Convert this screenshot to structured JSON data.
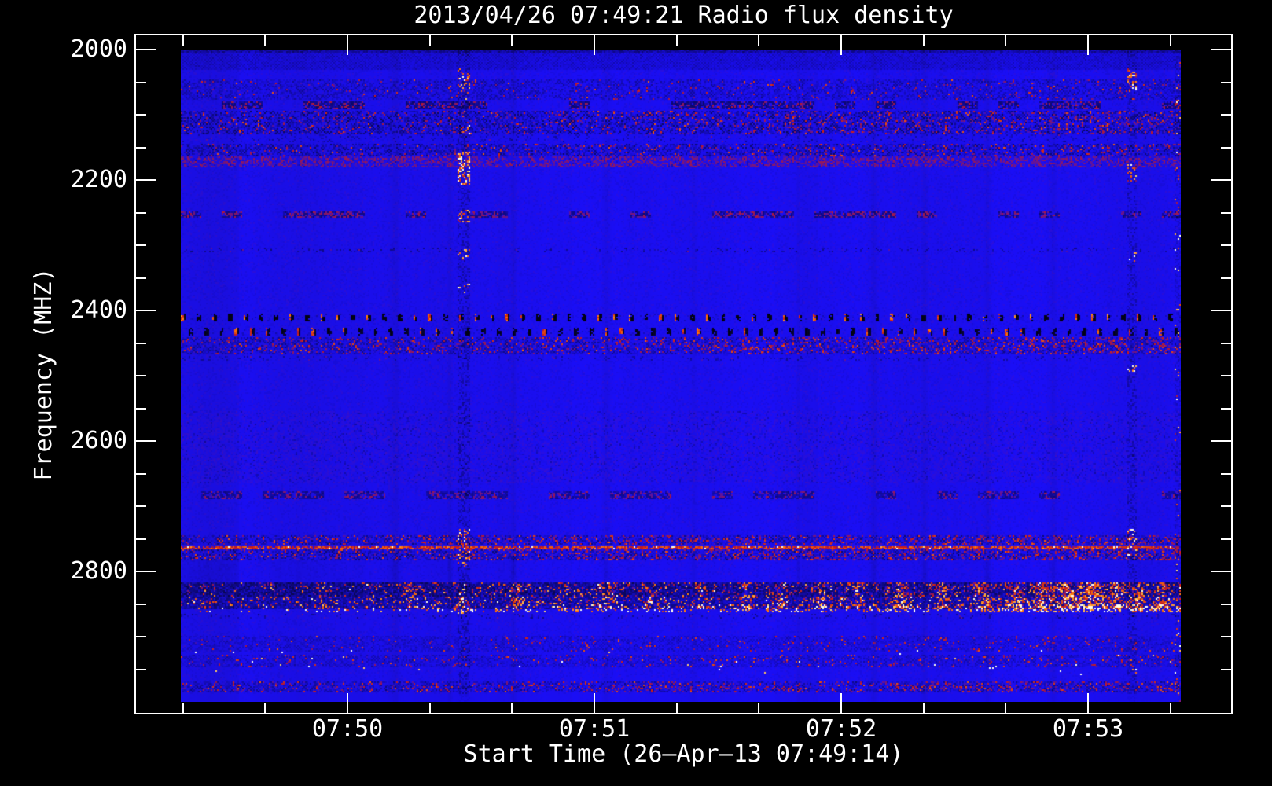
{
  "chart_data": {
    "type": "heatmap",
    "subtype": "radio-dynamic-spectrum",
    "title": "2013/04/26 07:49:21 Radio flux density",
    "xlabel": "Start Time (26–Apr–13 07:49:14)",
    "ylabel": "Frequency (MHZ)",
    "x_ticks": [
      "07:50",
      "07:51",
      "07:52",
      "07:53"
    ],
    "x_minor_step_seconds": 20,
    "y_ticks": [
      2000,
      2200,
      2400,
      2600,
      2800
    ],
    "y_minor_step_mhz": 50,
    "y_axis_increases_downward": true,
    "freq_range_mhz": [
      2000,
      3000
    ],
    "data_start_time": "07:49:21",
    "data_end_time_approx": "07:53:25",
    "grid": false,
    "legend": "none",
    "colormap": {
      "background_blue": "#1a0ee8",
      "dark": "#020214",
      "red": "#cd1c16",
      "orange": "#ff7a0a",
      "yellow": "#ffdc78",
      "white_hot": "#ffffeb"
    },
    "bands": [
      {
        "f0": 2000,
        "f1": 2004,
        "type": "dark",
        "s": 0.55
      },
      {
        "f0": 2005,
        "f1": 2032,
        "type": "checker",
        "s": 0.32
      },
      {
        "f0": 2046,
        "f1": 2077,
        "type": "mix",
        "s": 0.42,
        "redp": 0.05
      },
      {
        "f0": 2079,
        "f1": 2091,
        "type": "broken",
        "s": 0.5,
        "cov": 0.6,
        "red": 0.25
      },
      {
        "f0": 2093,
        "f1": 2129,
        "type": "mix",
        "s": 0.68,
        "redp": 0.16
      },
      {
        "f0": 2131,
        "f1": 2143,
        "type": "sparse",
        "s": 0.5
      },
      {
        "f0": 2145,
        "f1": 2163,
        "type": "mix",
        "s": 0.6,
        "redp": 0.12
      },
      {
        "f0": 2164,
        "f1": 2180,
        "type": "redfade",
        "s": 0.75
      },
      {
        "f0": 2249,
        "f1": 2257,
        "type": "broken",
        "s": 0.45,
        "cov": 0.5,
        "red": 0.45
      },
      {
        "f0": 2304,
        "f1": 2312,
        "type": "sparse",
        "s": 0.6
      },
      {
        "f0": 2406,
        "f1": 2417,
        "type": "dashes",
        "s": 0.9,
        "period": 19.6,
        "dash": 4.6,
        "phase": 0,
        "redp": 0.6
      },
      {
        "f0": 2427,
        "f1": 2439,
        "type": "dashes",
        "s": 0.8,
        "period": 19.6,
        "dash": 4.6,
        "phase": 9,
        "redp": 0.45
      },
      {
        "f0": 2442,
        "f1": 2467,
        "type": "mix",
        "s": 0.5,
        "redp": 0.2
      },
      {
        "f0": 2470,
        "f1": 2477,
        "type": "sparse",
        "s": 0.5
      },
      {
        "f0": 2555,
        "f1": 2665,
        "type": "redfade",
        "s": 0.1
      },
      {
        "f0": 2678,
        "f1": 2689,
        "type": "broken",
        "s": 0.4,
        "cov": 0.55,
        "red": 0.3
      },
      {
        "f0": 2744,
        "f1": 2760,
        "type": "mix",
        "s": 0.55,
        "redp": 0.22
      },
      {
        "f0": 2761,
        "f1": 2766,
        "type": "redline",
        "s": 0.8
      },
      {
        "f0": 2767,
        "f1": 2783,
        "type": "mix",
        "s": 0.6,
        "redp": 0.25
      },
      {
        "f0": 2784,
        "f1": 2816,
        "type": "vstripe",
        "s": 1
      },
      {
        "f0": 2818,
        "f1": 2857,
        "type": "hot",
        "s": 0.8
      },
      {
        "f0": 2850,
        "f1": 2862,
        "type": "hotdots",
        "s": 0.8
      },
      {
        "f0": 2864,
        "f1": 2872,
        "type": "sparse",
        "s": 0.6
      },
      {
        "f0": 2898,
        "f1": 2924,
        "type": "mix",
        "s": 0.3,
        "redp": 0.05
      },
      {
        "f0": 2927,
        "f1": 2947,
        "type": "mix",
        "s": 0.33,
        "redp": 0.07
      },
      {
        "f0": 2920,
        "f1": 2960,
        "type": "ydots",
        "s": 1
      },
      {
        "f0": 2968,
        "f1": 2986,
        "type": "mix",
        "s": 0.5,
        "redp": 0.2
      },
      {
        "f0": 2988,
        "f1": 3000,
        "type": "flat",
        "s": 1
      }
    ],
    "vertical_events": [
      {
        "x_frac": 0.2815,
        "w": 16,
        "dark": 0.5,
        "time_approx": "07:50:30",
        "ranges": [
          [
            2028,
            2078,
            0.5
          ],
          [
            2115,
            2130,
            0.45
          ],
          [
            2156,
            2208,
            0.85
          ],
          [
            2246,
            2264,
            0.5
          ],
          [
            2306,
            2322,
            0.4
          ],
          [
            2360,
            2374,
            0.3
          ],
          [
            2736,
            2795,
            0.5
          ],
          [
            2840,
            2865,
            0.35
          ]
        ]
      },
      {
        "x_frac": 0.951,
        "w": 12,
        "dark": 0.45,
        "time_approx": "07:53:15",
        "ranges": [
          [
            2028,
            2064,
            0.6
          ],
          [
            2175,
            2202,
            0.5
          ],
          [
            2310,
            2326,
            0.35
          ],
          [
            2478,
            2497,
            0.3
          ],
          [
            2736,
            2778,
            0.5
          ],
          [
            2935,
            2958,
            0.25
          ]
        ]
      },
      {
        "x_frac": 0.996,
        "w": 8,
        "dark": 0.3,
        "time_approx": "07:53:24",
        "ranges": [
          [
            2000,
            3000,
            0.1
          ]
        ]
      }
    ],
    "dark_columns": [
      0.214,
      0.268,
      0.332,
      0.425,
      0.512,
      0.617,
      0.692,
      0.743,
      0.806,
      0.872
    ],
    "hot_columns": [
      [
        0.025,
        8,
        0.35
      ],
      [
        0.09,
        6,
        0.3
      ],
      [
        0.145,
        10,
        0.4
      ],
      [
        0.19,
        6,
        0.35
      ],
      [
        0.23,
        12,
        0.5
      ],
      [
        0.28,
        8,
        0.45
      ],
      [
        0.335,
        10,
        0.55
      ],
      [
        0.38,
        8,
        0.5
      ],
      [
        0.425,
        14,
        0.6
      ],
      [
        0.47,
        8,
        0.5
      ],
      [
        0.52,
        6,
        0.45
      ],
      [
        0.565,
        10,
        0.6
      ],
      [
        0.6,
        8,
        0.5
      ],
      [
        0.64,
        10,
        0.55
      ],
      [
        0.675,
        8,
        0.5
      ],
      [
        0.72,
        10,
        0.6
      ],
      [
        0.76,
        8,
        0.55
      ],
      [
        0.8,
        12,
        0.65
      ],
      [
        0.835,
        10,
        0.7
      ],
      [
        0.862,
        14,
        0.85
      ],
      [
        0.885,
        10,
        0.9
      ],
      [
        0.91,
        16,
        1.0
      ],
      [
        0.935,
        8,
        0.8
      ],
      [
        0.955,
        10,
        0.7
      ],
      [
        0.98,
        8,
        0.6
      ]
    ]
  }
}
